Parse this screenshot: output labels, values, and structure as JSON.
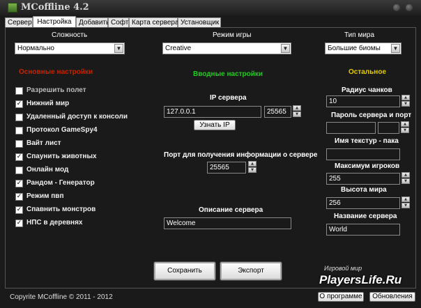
{
  "window": {
    "title": "MCoffline 4.2"
  },
  "tabs": [
    "Сервер",
    "Настройка",
    "Добавить",
    "Софт",
    "Карта сервера",
    "Установщик"
  ],
  "top": {
    "difficulty_label": "Сложность",
    "difficulty_value": "Нормально",
    "gamemode_label": "Режим игры",
    "gamemode_value": "Creative",
    "worldtype_label": "Тип мира",
    "worldtype_value": "Большие биомы"
  },
  "sections": {
    "main": "Основные настройки",
    "input": "Вводные настройки",
    "other": "Остальное"
  },
  "colors": {
    "main": "#cc2200",
    "input": "#22cc22",
    "other": "#e6cc00"
  },
  "checkboxes": [
    {
      "label": "Разрешить полет",
      "checked": false
    },
    {
      "label": "Нижний мир",
      "checked": true
    },
    {
      "label": "Удаленный доступ к консоли",
      "checked": false
    },
    {
      "label": "Протокол GameSpy4",
      "checked": false
    },
    {
      "label": "Вайт лист",
      "checked": false
    },
    {
      "label": "Спаунить животных",
      "checked": true
    },
    {
      "label": "Онлайн мод",
      "checked": false
    },
    {
      "label": "Рандом - Генератор",
      "checked": true
    },
    {
      "label": "Режим пвп",
      "checked": true
    },
    {
      "label": "Спавнить монстров",
      "checked": true
    },
    {
      "label": "НПС в деревнях",
      "checked": true
    }
  ],
  "middle": {
    "ip_label": "IP сервера",
    "ip_value": "127.0.0.1",
    "port_value": "25565",
    "find_ip_button": "Узнать IP",
    "query_port_label": "Порт для получения информации о сервере",
    "query_port_value": "25565",
    "description_label": "Описание сервера",
    "description_value": "Welcome"
  },
  "right": {
    "chunk_radius_label": "Радиус чанков",
    "chunk_radius_value": "10",
    "password_label": "Пароль сервера и порт",
    "password_value": "",
    "password_port_value": "",
    "texture_label": "Имя текстур - пака",
    "texture_value": "",
    "max_players_label": "Максимум игроков",
    "max_players_value": "255",
    "height_label": "Высота мира",
    "height_value": "256",
    "server_name_label": "Название сервера",
    "server_name_value": "World"
  },
  "buttons": {
    "save": "Сохранить",
    "export": "Экспорт",
    "about": "О программе",
    "updates": "Обновления"
  },
  "footer": {
    "copyright": "Copyrite MCoffline © 2011 - 2012"
  },
  "watermark": {
    "small": "Игровой мир",
    "big": "PlayersLife.Ru"
  }
}
